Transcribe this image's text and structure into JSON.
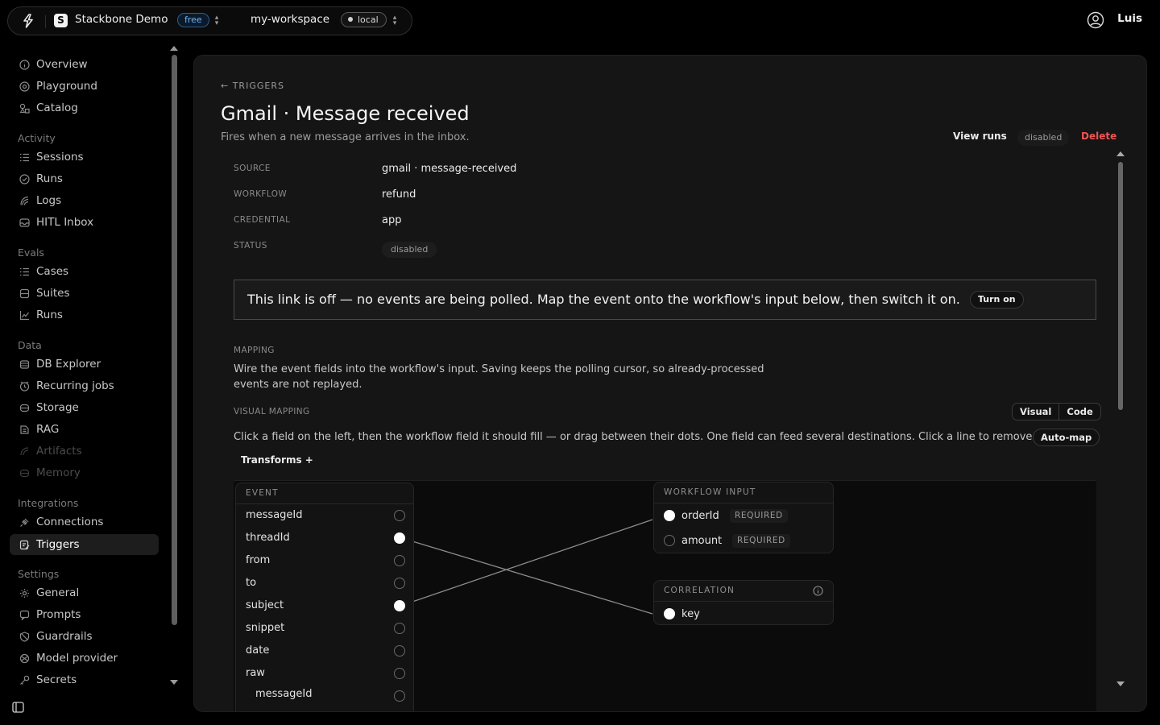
{
  "topbar": {
    "project_name": "Stackbone Demo",
    "project_initial": "S",
    "plan_badge": "free",
    "workspace_name": "my-workspace",
    "env_badge": "local",
    "user_name": "Luis"
  },
  "sidebar": {
    "top_items": [
      {
        "label": "Overview",
        "icon": "info-circle-icon"
      },
      {
        "label": "Playground",
        "icon": "target-icon"
      },
      {
        "label": "Catalog",
        "icon": "shapes-icon"
      }
    ],
    "groups": {
      "activity": "Activity",
      "evals": "Evals",
      "data": "Data",
      "integrations": "Integrations",
      "settings": "Settings"
    },
    "activity_items": [
      {
        "label": "Sessions",
        "icon": "list-icon"
      },
      {
        "label": "Runs",
        "icon": "check-circle-icon"
      },
      {
        "label": "Logs",
        "icon": "logs-icon"
      },
      {
        "label": "HITL Inbox",
        "icon": "inbox-icon"
      }
    ],
    "evals_items": [
      {
        "label": "Cases",
        "icon": "list-icon"
      },
      {
        "label": "Suites",
        "icon": "layers-icon"
      },
      {
        "label": "Runs",
        "icon": "chart-icon"
      }
    ],
    "data_items": [
      {
        "label": "DB Explorer",
        "icon": "database-icon"
      },
      {
        "label": "Recurring jobs",
        "icon": "clock-icon"
      },
      {
        "label": "Storage",
        "icon": "storage-icon"
      },
      {
        "label": "RAG",
        "icon": "rag-icon"
      },
      {
        "label": "Artifacts",
        "icon": "artifact-icon"
      },
      {
        "label": "Memory",
        "icon": "memory-icon"
      }
    ],
    "integrations_items": [
      {
        "label": "Connections",
        "icon": "plug-icon"
      },
      {
        "label": "Triggers",
        "icon": "triggers-icon"
      }
    ],
    "settings_items": [
      {
        "label": "General",
        "icon": "gear-icon"
      },
      {
        "label": "Prompts",
        "icon": "prompt-icon"
      },
      {
        "label": "Guardrails",
        "icon": "shield-icon"
      },
      {
        "label": "Model provider",
        "icon": "model-icon"
      },
      {
        "label": "Secrets",
        "icon": "key-icon"
      }
    ]
  },
  "page": {
    "back_label": "← TRIGGERS",
    "title": "Gmail · Message received",
    "subtitle": "Fires when a new message arrives in the inbox.",
    "actions": {
      "view_runs": "View runs",
      "status": "disabled",
      "delete": "Delete"
    },
    "details": {
      "source_key": "SOURCE",
      "source_value": "gmail · message-received",
      "workflow_key": "WORKFLOW",
      "workflow_value": "refund",
      "credential_key": "CREDENTIAL",
      "credential_value": "app",
      "status_key": "STATUS",
      "status_value": "disabled"
    },
    "notice": {
      "text": "This link is off — no events are being polled. Map the event onto the workflow's input below, then switch it on.",
      "button": "Turn on"
    },
    "mapping": {
      "label": "MAPPING",
      "description_line1": "Wire the event fields into the workflow's input. Saving keeps the polling cursor, so already-processed",
      "description_line2": "events are not replayed.",
      "visual_label": "VISUAL MAPPING",
      "mode_visual": "Visual",
      "mode_code": "Code",
      "hint": "Click a field on the left, then the workflow field it should fill — or drag between their dots. One field can feed several destinations. Click a line to remove it.",
      "auto_map": "Auto-map",
      "transforms": "Transforms +"
    },
    "event_node": {
      "header": "EVENT",
      "fields": [
        {
          "name": "messageId",
          "connected": false
        },
        {
          "name": "threadId",
          "connected": true
        },
        {
          "name": "from",
          "connected": false
        },
        {
          "name": "to",
          "connected": false
        },
        {
          "name": "subject",
          "connected": true
        },
        {
          "name": "snippet",
          "connected": false
        },
        {
          "name": "date",
          "connected": false
        },
        {
          "name": "raw",
          "connected": false
        },
        {
          "name": "messageId",
          "connected": false
        }
      ]
    },
    "workflow_node": {
      "header": "WORKFLOW INPUT",
      "fields": [
        {
          "name": "orderId",
          "badge": "REQUIRED",
          "connected": true
        },
        {
          "name": "amount",
          "badge": "REQUIRED",
          "connected": false
        }
      ]
    },
    "correlation_node": {
      "header": "CORRELATION",
      "fields": [
        {
          "name": "key",
          "connected": true
        }
      ]
    },
    "connections": [
      {
        "from": "threadId",
        "to": "key"
      },
      {
        "from": "subject",
        "to": "orderId"
      }
    ]
  }
}
